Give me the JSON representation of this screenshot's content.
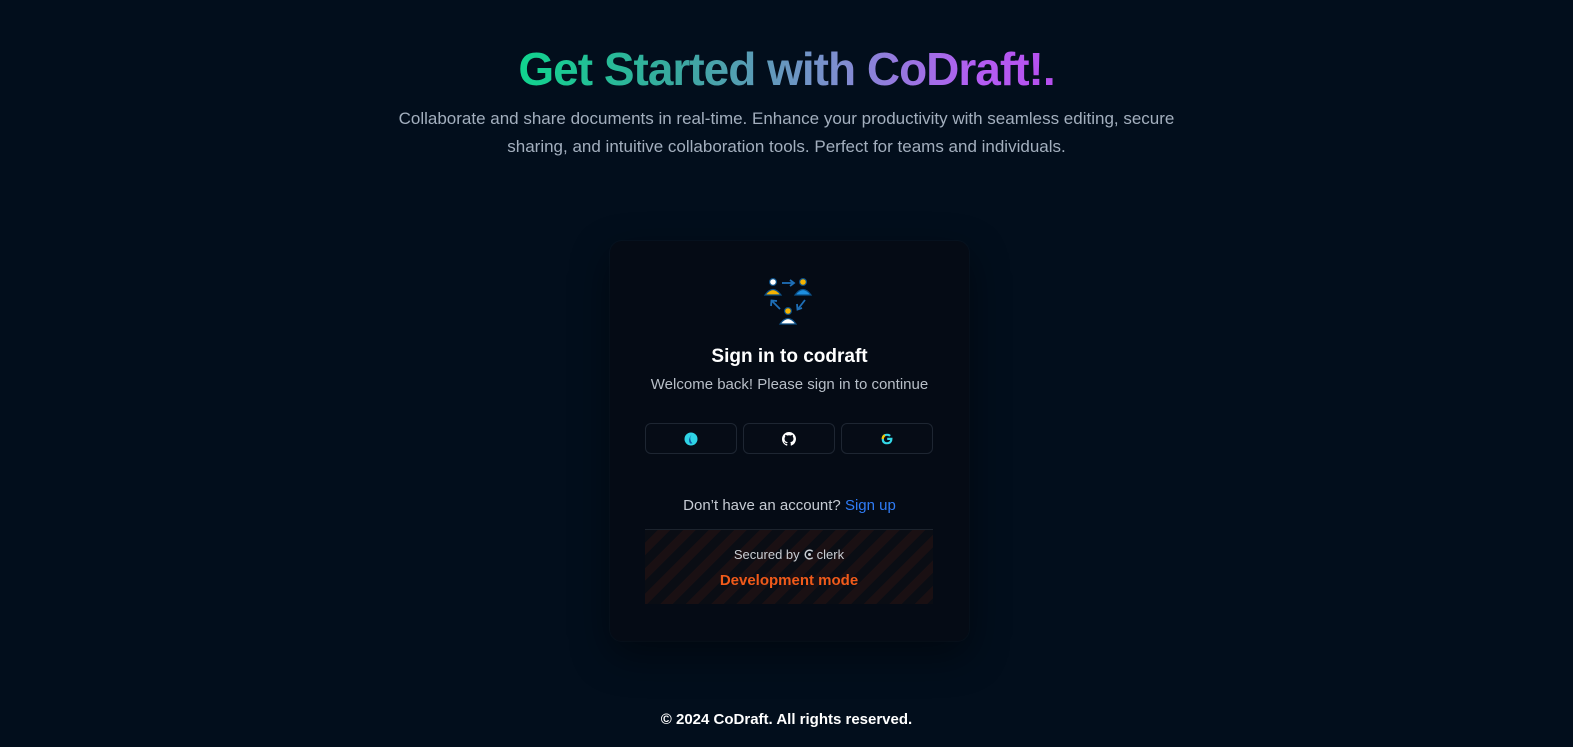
{
  "hero": {
    "title": "Get Started with CoDraft!.",
    "subtitle": "Collaborate and share documents in real-time. Enhance your productivity with seamless editing, secure sharing, and intuitive collaboration tools. Perfect for teams and individuals."
  },
  "signin": {
    "logo_icon": "team-collaboration-icon",
    "title": "Sign in to codraft",
    "subtitle": "Welcome back! Please sign in to continue",
    "social": [
      {
        "provider": "atlassian",
        "icon": "atlassian-icon"
      },
      {
        "provider": "github",
        "icon": "github-icon"
      },
      {
        "provider": "google",
        "icon": "google-icon"
      }
    ],
    "signup_prompt": "Don’t have an account?",
    "signup_link": "Sign up",
    "secured_by": "Secured by",
    "secured_brand": "clerk",
    "dev_mode": "Development mode"
  },
  "footer": {
    "copyright": "© 2024 CoDraft. All rights reserved."
  },
  "colors": {
    "background": "#020e1c",
    "card": "#050b15",
    "link": "#2f7cf6",
    "dev_mode": "#f05a1a",
    "gradient_start": "#10d48e",
    "gradient_end": "#b64fee"
  }
}
